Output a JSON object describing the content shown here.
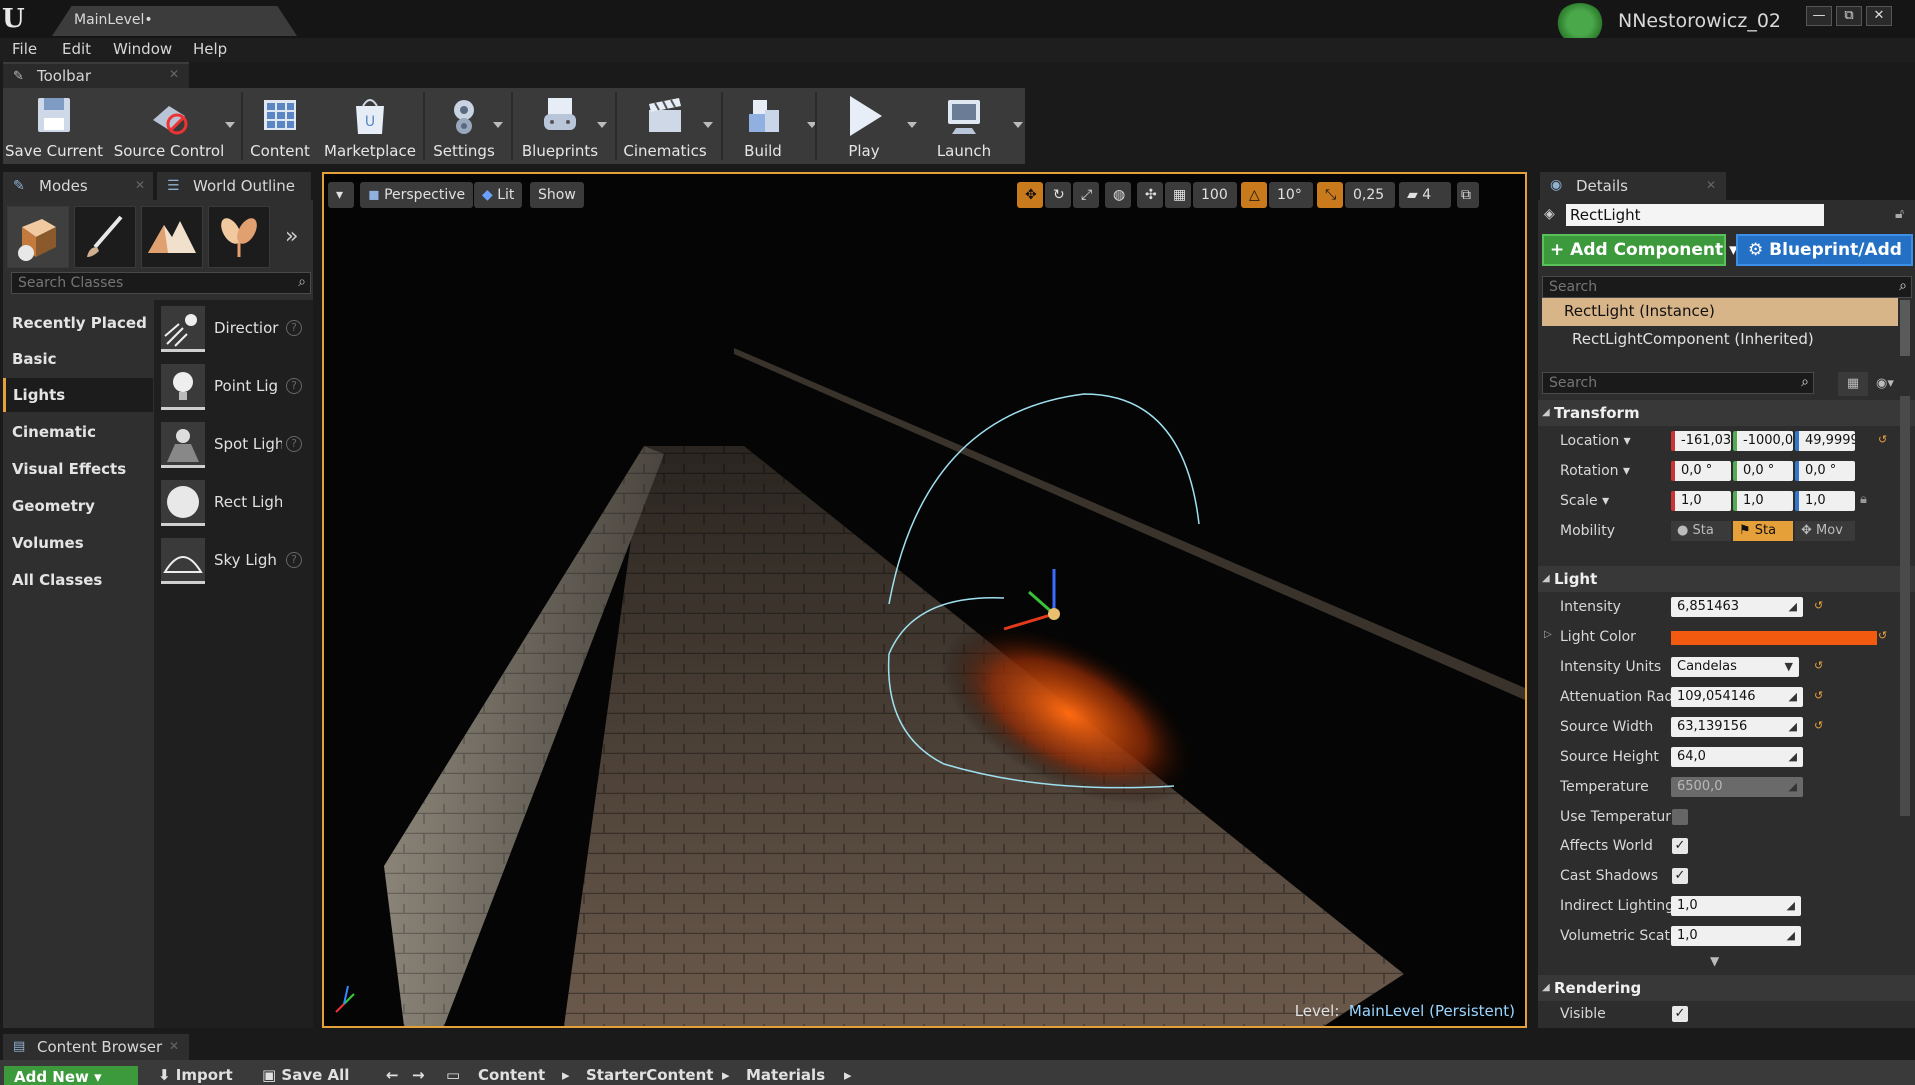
{
  "window": {
    "tab_title": "MainLevel•",
    "username": "NNestorowicz_02",
    "buttons": [
      "—",
      "⧉",
      "✕"
    ]
  },
  "menu": [
    "File",
    "Edit",
    "Window",
    "Help"
  ],
  "toolbar_tab": "Toolbar",
  "toolbar": {
    "items": [
      "Save Current",
      "Source Control",
      "Content",
      "Marketplace",
      "Settings",
      "Blueprints",
      "Cinematics",
      "Build",
      "Play",
      "Launch"
    ]
  },
  "left_tabs": {
    "modes": "Modes",
    "outliner": "World Outline"
  },
  "search_classes": {
    "placeholder": "Search Classes"
  },
  "categories": [
    "Recently Placed",
    "Basic",
    "Lights",
    "Cinematic",
    "Visual Effects",
    "Geometry",
    "Volumes",
    "All Classes"
  ],
  "active_category": "Lights",
  "placeables": [
    "Directior",
    "Point Lig",
    "Spot Ligh",
    "Rect Light",
    "Sky Ligh"
  ],
  "viewport": {
    "view_mode": "Perspective",
    "lighting": "Lit",
    "show": "Show",
    "grid_snap": "100",
    "rot_snap": "10°",
    "scale_snap": "0,25",
    "cam_speed": "4",
    "level_label": "Level:",
    "level_name": "MainLevel (Persistent)"
  },
  "details": {
    "tab": "Details",
    "actor_name": "RectLight",
    "add_component": "+ Add Component ▾",
    "blueprint_add": "Blueprint/Add",
    "search_placeholder": "Search",
    "components": [
      "RectLight (Instance)",
      "RectLightComponent (Inherited)"
    ],
    "transform": {
      "title": "Transform",
      "location_label": "Location ▾",
      "location": [
        "-161,03",
        "-1000,0",
        "49,9999"
      ],
      "rotation_label": "Rotation ▾",
      "rotation": [
        "0,0 °",
        "0,0 °",
        "0,0 °"
      ],
      "scale_label": "Scale ▾",
      "scale": [
        "1,0",
        "1,0",
        "1,0"
      ],
      "mobility_label": "Mobility",
      "mobility": [
        "Sta",
        "Sta",
        "Mov"
      ]
    },
    "light": {
      "title": "Light",
      "intensity_label": "Intensity",
      "intensity": "6,851463",
      "color_label": "Light Color",
      "color": "#f25a10",
      "units_label": "Intensity Units",
      "units": "Candelas",
      "atten_label": "Attenuation Rad",
      "atten": "109,054146",
      "width_label": "Source Width",
      "width": "63,139156",
      "height_label": "Source Height",
      "height": "64,0",
      "temp_label": "Temperature",
      "temp": "6500,0",
      "usetemp_label": "Use Temperatur",
      "affects_label": "Affects World",
      "shadows_label": "Cast Shadows",
      "indirect_label": "Indirect Lighting",
      "indirect": "1,0",
      "volscat_label": "Volumetric Scat",
      "volscat": "1,0"
    },
    "rendering": {
      "title": "Rendering",
      "visible_label": "Visible"
    }
  },
  "content_browser": {
    "tab": "Content Browser",
    "add_new": "Add New ▾",
    "import": "Import",
    "save_all": "Save All",
    "path": [
      "Content",
      "StarterContent",
      "Materials"
    ]
  }
}
